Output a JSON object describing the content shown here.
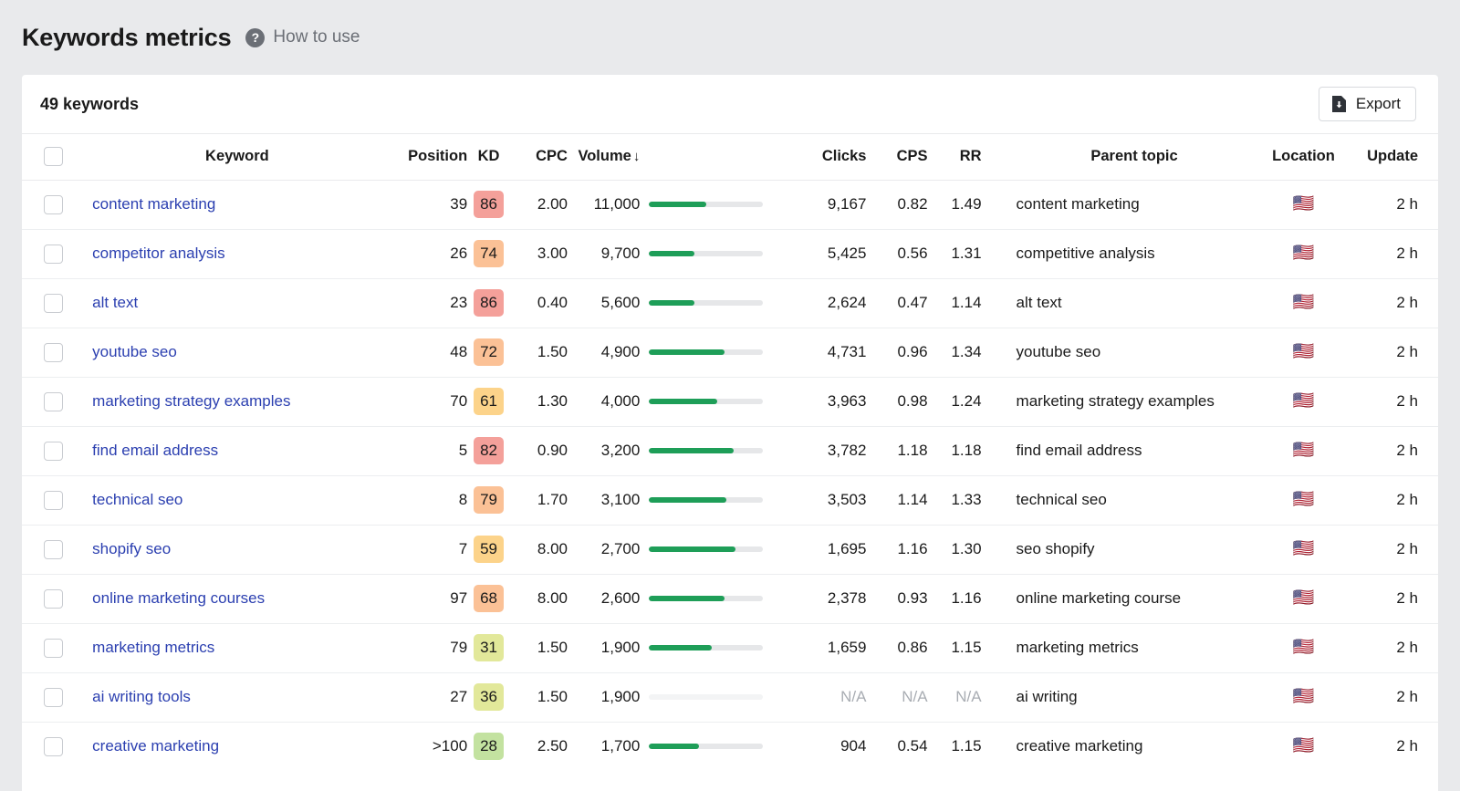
{
  "header": {
    "title": "Keywords metrics",
    "help_icon": "question-mark-circle-icon",
    "howto_label": "How to use"
  },
  "toolbar": {
    "keyword_count_label": "49 keywords",
    "export_label": "Export",
    "export_icon": "file-download-icon"
  },
  "table": {
    "columns": {
      "keyword": "Keyword",
      "position": "Position",
      "kd": "KD",
      "cpc": "CPC",
      "volume": "Volume",
      "volume_sort": "↓",
      "clicks": "Clicks",
      "cps": "CPS",
      "rr": "RR",
      "parent_topic": "Parent topic",
      "location": "Location",
      "update": "Update"
    },
    "rows": [
      {
        "keyword": "content marketing",
        "position": "39",
        "kd": "86",
        "kd_color": "#f4a09a",
        "cpc": "2.00",
        "volume": "11,000",
        "volume_pct": 50,
        "clicks": "9,167",
        "cps": "0.82",
        "rr": "1.49",
        "parent_topic": "content marketing",
        "location": "🇺🇸",
        "update": "2 h"
      },
      {
        "keyword": "competitor analysis",
        "position": "26",
        "kd": "74",
        "kd_color": "#fbc196",
        "cpc": "3.00",
        "volume": "9,700",
        "volume_pct": 40,
        "clicks": "5,425",
        "cps": "0.56",
        "rr": "1.31",
        "parent_topic": "competitive analysis",
        "location": "🇺🇸",
        "update": "2 h"
      },
      {
        "keyword": "alt text",
        "position": "23",
        "kd": "86",
        "kd_color": "#f4a09a",
        "cpc": "0.40",
        "volume": "5,600",
        "volume_pct": 40,
        "clicks": "2,624",
        "cps": "0.47",
        "rr": "1.14",
        "parent_topic": "alt text",
        "location": "🇺🇸",
        "update": "2 h"
      },
      {
        "keyword": "youtube seo",
        "position": "48",
        "kd": "72",
        "kd_color": "#fbc196",
        "cpc": "1.50",
        "volume": "4,900",
        "volume_pct": 66,
        "clicks": "4,731",
        "cps": "0.96",
        "rr": "1.34",
        "parent_topic": "youtube seo",
        "location": "🇺🇸",
        "update": "2 h"
      },
      {
        "keyword": "marketing strategy examples",
        "position": "70",
        "kd": "61",
        "kd_color": "#fcd38a",
        "cpc": "1.30",
        "volume": "4,000",
        "volume_pct": 60,
        "clicks": "3,963",
        "cps": "0.98",
        "rr": "1.24",
        "parent_topic": "marketing strategy examples",
        "location": "🇺🇸",
        "update": "2 h"
      },
      {
        "keyword": "find email address",
        "position": "5",
        "kd": "82",
        "kd_color": "#f4a09a",
        "cpc": "0.90",
        "volume": "3,200",
        "volume_pct": 74,
        "clicks": "3,782",
        "cps": "1.18",
        "rr": "1.18",
        "parent_topic": "find email address",
        "location": "🇺🇸",
        "update": "2 h"
      },
      {
        "keyword": "technical seo",
        "position": "8",
        "kd": "79",
        "kd_color": "#fbc196",
        "cpc": "1.70",
        "volume": "3,100",
        "volume_pct": 68,
        "clicks": "3,503",
        "cps": "1.14",
        "rr": "1.33",
        "parent_topic": "technical seo",
        "location": "🇺🇸",
        "update": "2 h"
      },
      {
        "keyword": "shopify seo",
        "position": "7",
        "kd": "59",
        "kd_color": "#fcd38a",
        "cpc": "8.00",
        "volume": "2,700",
        "volume_pct": 76,
        "clicks": "1,695",
        "cps": "1.16",
        "rr": "1.30",
        "parent_topic": "seo shopify",
        "location": "🇺🇸",
        "update": "2 h"
      },
      {
        "keyword": "online marketing courses",
        "position": "97",
        "kd": "68",
        "kd_color": "#fbc196",
        "cpc": "8.00",
        "volume": "2,600",
        "volume_pct": 66,
        "clicks": "2,378",
        "cps": "0.93",
        "rr": "1.16",
        "parent_topic": "online marketing course",
        "location": "🇺🇸",
        "update": "2 h"
      },
      {
        "keyword": "marketing metrics",
        "position": "79",
        "kd": "31",
        "kd_color": "#e2e89a",
        "cpc": "1.50",
        "volume": "1,900",
        "volume_pct": 55,
        "clicks": "1,659",
        "cps": "0.86",
        "rr": "1.15",
        "parent_topic": "marketing metrics",
        "location": "🇺🇸",
        "update": "2 h"
      },
      {
        "keyword": "ai writing tools",
        "position": "27",
        "kd": "36",
        "kd_color": "#e2e89a",
        "cpc": "1.50",
        "volume": "1,900",
        "volume_pct": 0,
        "clicks": "N/A",
        "cps": "N/A",
        "rr": "N/A",
        "parent_topic": "ai writing",
        "location": "🇺🇸",
        "update": "2 h"
      },
      {
        "keyword": "creative marketing",
        "position": ">100",
        "kd": "28",
        "kd_color": "#c3e2a0",
        "cpc": "2.50",
        "volume": "1,700",
        "volume_pct": 44,
        "clicks": "904",
        "cps": "0.54",
        "rr": "1.15",
        "parent_topic": "creative marketing",
        "location": "🇺🇸",
        "update": "2 h"
      }
    ]
  },
  "colors": {
    "link": "#2b3fb0",
    "bar_fill": "#1e9e58",
    "bar_track": "#e6e7e9",
    "page_bg": "#e9eaec",
    "na_text": "#a9adb3"
  }
}
